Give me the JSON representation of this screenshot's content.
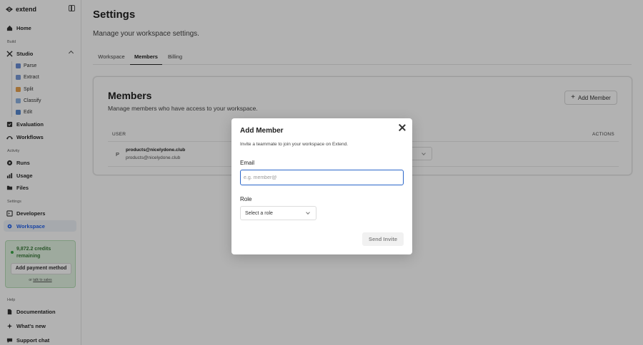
{
  "app": {
    "brand": "extend"
  },
  "sidebar": {
    "home": "Home",
    "build_label": "Build",
    "studio": "Studio",
    "studio_items": [
      {
        "label": "Parse",
        "icon": "parse-icon",
        "color": "#6b8fd6"
      },
      {
        "label": "Extract",
        "icon": "extract-icon",
        "color": "#7a9bd8"
      },
      {
        "label": "Split",
        "icon": "split-icon",
        "color": "#e8a24f"
      },
      {
        "label": "Classify",
        "icon": "classify-icon",
        "color": "#8fb3e3"
      },
      {
        "label": "Edit",
        "icon": "edit-icon",
        "color": "#5a8ad0"
      }
    ],
    "evaluation": "Evaluation",
    "workflows": "Workflows",
    "activity_label": "Activity",
    "runs": "Runs",
    "usage": "Usage",
    "files": "Files",
    "settings_label": "Settings",
    "developers": "Developers",
    "workspace": "Workspace",
    "credits": {
      "text": "9,872.2 credits remaining",
      "payment_button": "Add payment method",
      "foot_prefix": "or",
      "foot_link": "talk to sales"
    },
    "help_label": "Help",
    "documentation": "Documentation",
    "whats_new": "What's new",
    "support_chat": "Support chat"
  },
  "header": {
    "title": "Settings",
    "subtitle": "Manage your workspace settings."
  },
  "tabs": [
    {
      "label": "Workspace",
      "active": false
    },
    {
      "label": "Members",
      "active": true
    },
    {
      "label": "Billing",
      "active": false
    }
  ],
  "members_card": {
    "title": "Members",
    "subtitle": "Manage members who have access to your workspace.",
    "add_button": "Add Member",
    "columns": {
      "user": "USER",
      "actions": "ACTIONS"
    },
    "rows": [
      {
        "avatar": "P",
        "name": "products@nicelydone.club",
        "email": "products@nicelydone.club"
      }
    ]
  },
  "modal": {
    "title": "Add Member",
    "description": "Invite a teammate to join your workspace on Extend.",
    "email_label": "Email",
    "email_placeholder": "e.g. member@",
    "email_value": "",
    "role_label": "Role",
    "role_value": "Select a role",
    "send_button": "Send Invite"
  },
  "colors": {
    "accent": "#2563eb",
    "credits_bg": "#e3f4e3",
    "credits_text": "#3a7a3a",
    "overlay": "rgba(0,0,0,0.30)"
  }
}
